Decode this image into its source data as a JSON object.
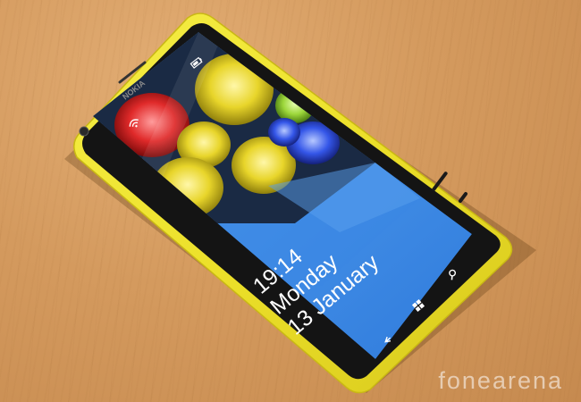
{
  "phone": {
    "brand": "NOKIA",
    "body_color": "#f0e62a",
    "screen_accent": "#3a86e4"
  },
  "lockscreen": {
    "time": "19:14",
    "day": "Monday",
    "date": "13 January"
  },
  "status_icons": [
    "wifi-icon",
    "battery-icon"
  ],
  "nav_buttons": [
    "back-icon",
    "windows-icon",
    "search-icon"
  ],
  "watermark": "fonearena"
}
